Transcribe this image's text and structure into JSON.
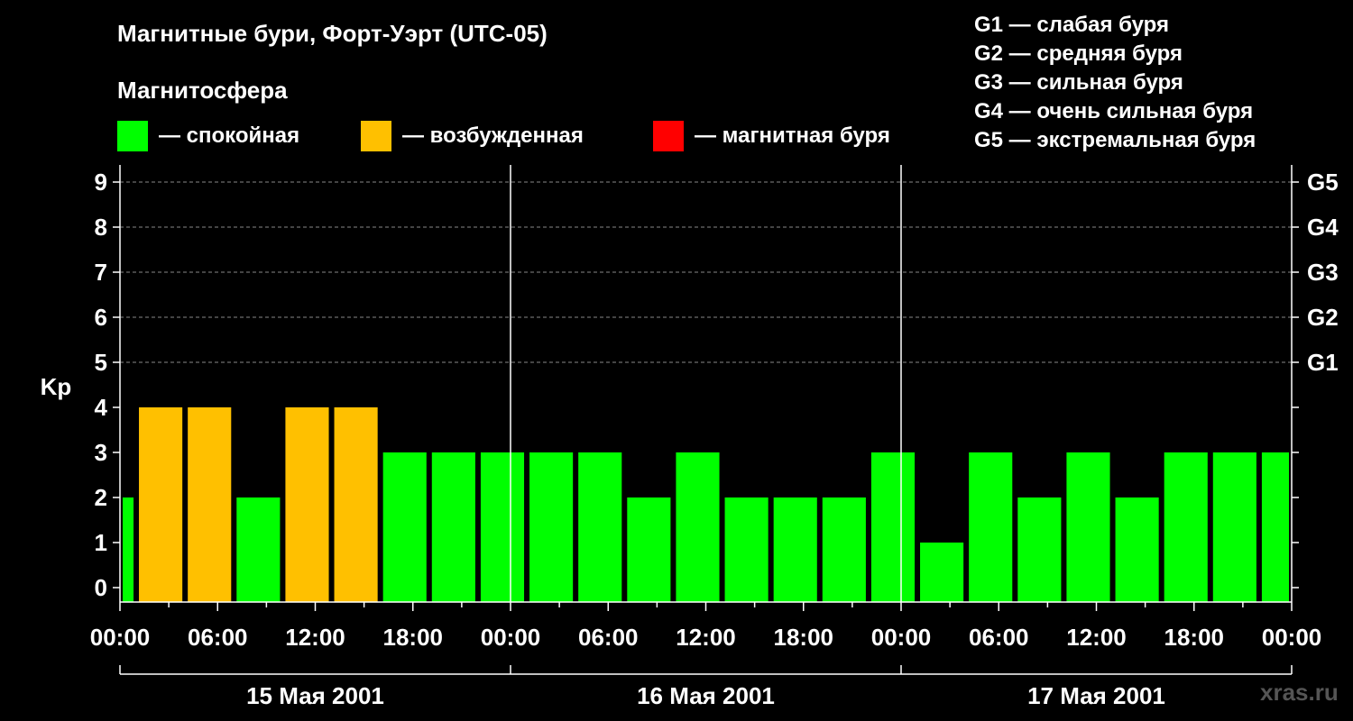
{
  "title": "Магнитные бури, Форт-Уэрт (UTC-05)",
  "subtitle": "Магнитосфера",
  "legend": [
    {
      "color": "#00ff00",
      "label": "— спокойная"
    },
    {
      "color": "#ffc000",
      "label": "— возбужденная"
    },
    {
      "color": "#ff0000",
      "label": "— магнитная буря"
    }
  ],
  "g_scale": [
    "G1 — слабая буря",
    "G2 — средняя буря",
    "G3 — сильная буря",
    "G4 — очень сильная буря",
    "G5 — экстремальная буря"
  ],
  "watermark": "xras.ru",
  "chart_data": {
    "type": "bar",
    "ylabel": "Kp",
    "ylim": [
      0,
      9
    ],
    "y_ticks": [
      "0",
      "1",
      "2",
      "3",
      "4",
      "5",
      "6",
      "7",
      "8",
      "9"
    ],
    "g_ticks": [
      {
        "value": 5,
        "label": "G1"
      },
      {
        "value": 6,
        "label": "G2"
      },
      {
        "value": 7,
        "label": "G3"
      },
      {
        "value": 8,
        "label": "G4"
      },
      {
        "value": 9,
        "label": "G5"
      }
    ],
    "x_tick_labels": [
      "00:00",
      "06:00",
      "12:00",
      "18:00",
      "00:00",
      "06:00",
      "12:00",
      "18:00",
      "00:00",
      "06:00",
      "12:00",
      "18:00",
      "00:00"
    ],
    "days": [
      "15 Мая 2001",
      "16 Мая 2001",
      "17 Мая 2001"
    ],
    "colors": {
      "quiet": "#00ff00",
      "active": "#ffc000",
      "storm": "#ff0000"
    },
    "bars": [
      {
        "start_hour": 0,
        "end_hour": 1,
        "kp": 2,
        "level": "quiet"
      },
      {
        "start_hour": 1,
        "end_hour": 4,
        "kp": 4,
        "level": "active"
      },
      {
        "start_hour": 4,
        "end_hour": 7,
        "kp": 4,
        "level": "active"
      },
      {
        "start_hour": 7,
        "end_hour": 10,
        "kp": 2,
        "level": "quiet"
      },
      {
        "start_hour": 10,
        "end_hour": 13,
        "kp": 4,
        "level": "active"
      },
      {
        "start_hour": 13,
        "end_hour": 16,
        "kp": 4,
        "level": "active"
      },
      {
        "start_hour": 16,
        "end_hour": 19,
        "kp": 3,
        "level": "quiet"
      },
      {
        "start_hour": 19,
        "end_hour": 22,
        "kp": 3,
        "level": "quiet"
      },
      {
        "start_hour": 22,
        "end_hour": 25,
        "kp": 3,
        "level": "quiet"
      },
      {
        "start_hour": 25,
        "end_hour": 28,
        "kp": 3,
        "level": "quiet"
      },
      {
        "start_hour": 28,
        "end_hour": 31,
        "kp": 3,
        "level": "quiet"
      },
      {
        "start_hour": 31,
        "end_hour": 34,
        "kp": 2,
        "level": "quiet"
      },
      {
        "start_hour": 34,
        "end_hour": 37,
        "kp": 3,
        "level": "quiet"
      },
      {
        "start_hour": 37,
        "end_hour": 40,
        "kp": 2,
        "level": "quiet"
      },
      {
        "start_hour": 40,
        "end_hour": 43,
        "kp": 2,
        "level": "quiet"
      },
      {
        "start_hour": 43,
        "end_hour": 46,
        "kp": 2,
        "level": "quiet"
      },
      {
        "start_hour": 46,
        "end_hour": 49,
        "kp": 3,
        "level": "quiet"
      },
      {
        "start_hour": 49,
        "end_hour": 52,
        "kp": 1,
        "level": "quiet"
      },
      {
        "start_hour": 52,
        "end_hour": 55,
        "kp": 3,
        "level": "quiet"
      },
      {
        "start_hour": 55,
        "end_hour": 58,
        "kp": 2,
        "level": "quiet"
      },
      {
        "start_hour": 58,
        "end_hour": 61,
        "kp": 3,
        "level": "quiet"
      },
      {
        "start_hour": 61,
        "end_hour": 64,
        "kp": 2,
        "level": "quiet"
      },
      {
        "start_hour": 64,
        "end_hour": 67,
        "kp": 3,
        "level": "quiet"
      },
      {
        "start_hour": 67,
        "end_hour": 70,
        "kp": 3,
        "level": "quiet"
      },
      {
        "start_hour": 70,
        "end_hour": 72,
        "kp": 3,
        "level": "quiet"
      }
    ]
  }
}
